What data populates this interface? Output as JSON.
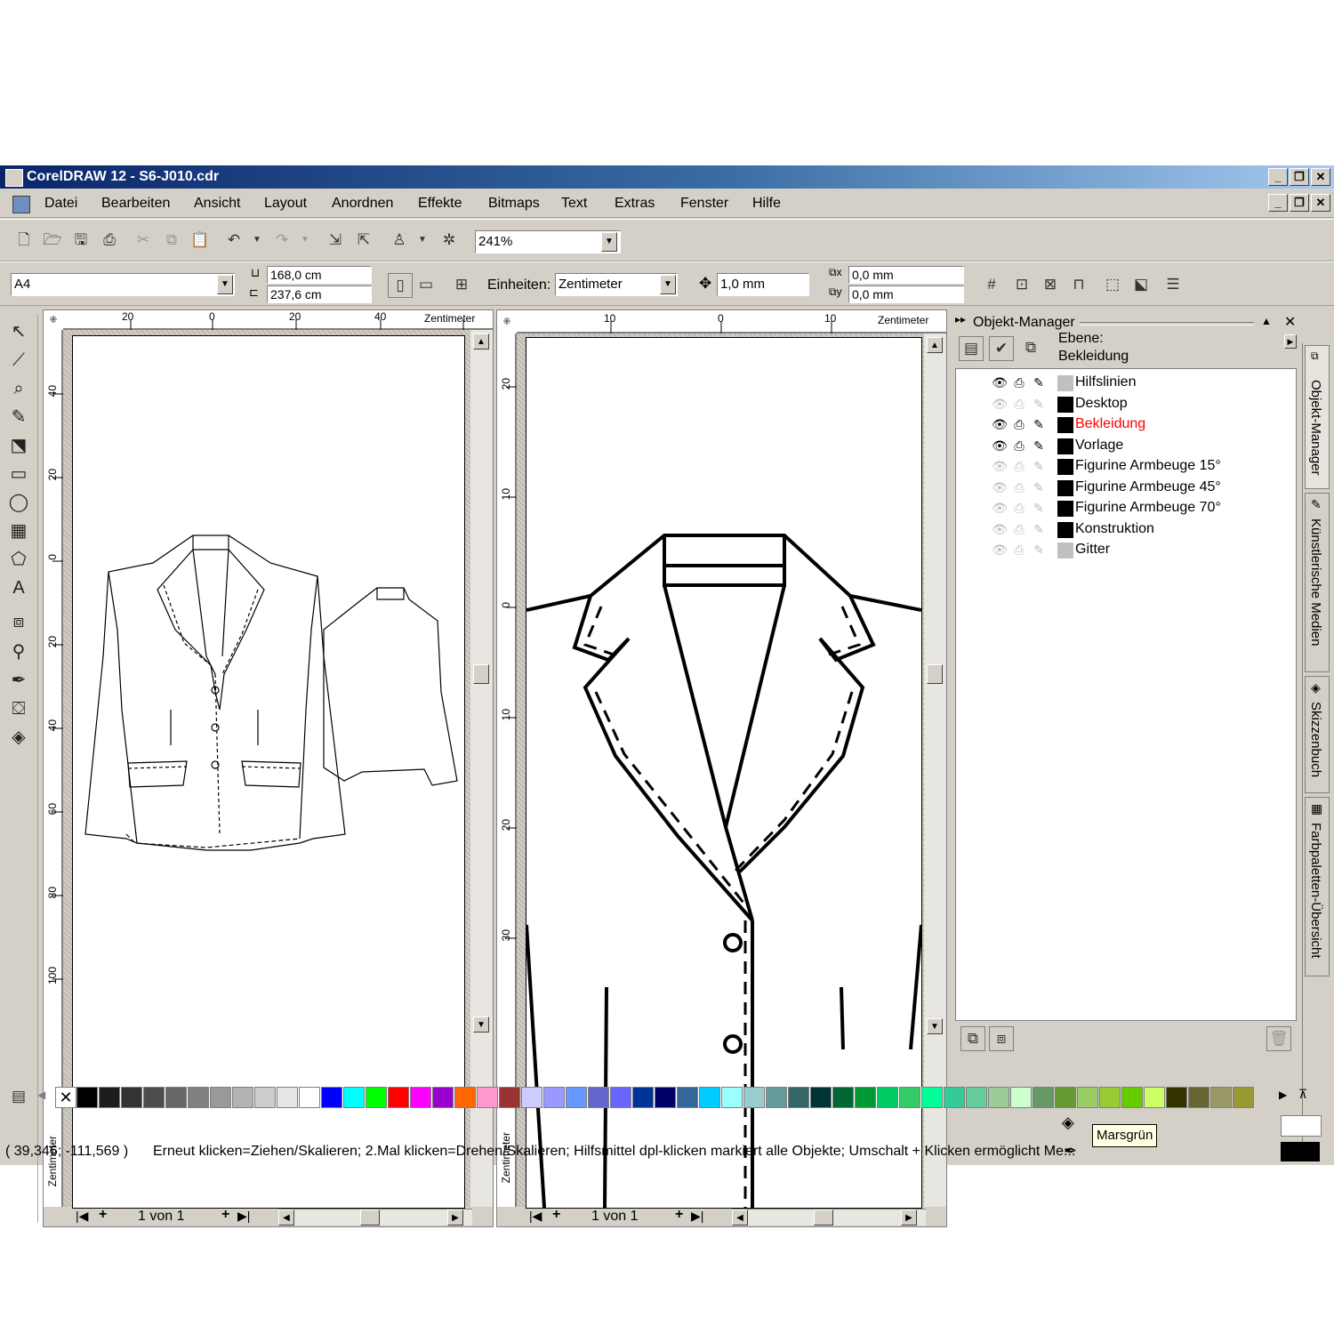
{
  "window": {
    "title": "CorelDRAW 12 - S6-J010.cdr"
  },
  "menu": [
    "Datei",
    "Bearbeiten",
    "Ansicht",
    "Layout",
    "Anordnen",
    "Effekte",
    "Bitmaps",
    "Text",
    "Extras",
    "Fenster",
    "Hilfe"
  ],
  "standard_toolbar": {
    "zoom": "241%"
  },
  "property_bar": {
    "paper_size": "A4",
    "width": "168,0 cm",
    "height": "237,6 cm",
    "units_label": "Einheiten:",
    "units_value": "Zentimeter",
    "nudge": "1,0 mm",
    "dup_x": "0,0 mm",
    "dup_y": "0,0 mm"
  },
  "left_view": {
    "ruler_unit": "Zentimeter",
    "h_ticks": [
      "20",
      "0",
      "20",
      "40"
    ],
    "v_ticks": [
      "40",
      "20",
      "0",
      "20",
      "40",
      "60",
      "80",
      "100"
    ],
    "page_nav": "1 von 1"
  },
  "right_view": {
    "ruler_unit": "Zentimeter",
    "h_ticks": [
      "10",
      "0",
      "10"
    ],
    "v_ticks": [
      "20",
      "10",
      "0",
      "10",
      "20",
      "30"
    ],
    "page_nav": "1 von 1"
  },
  "object_manager": {
    "title": "Objekt-Manager",
    "layer_label": "Ebene:",
    "layer_value": "Bekleidung",
    "layers": [
      {
        "name": "Hilfslinien",
        "color": "#c0c0c0",
        "active": false,
        "visible": true
      },
      {
        "name": "Desktop",
        "color": "#000000",
        "active": false,
        "visible": false
      },
      {
        "name": "Bekleidung",
        "color": "#000000",
        "active": true,
        "visible": true
      },
      {
        "name": "Vorlage",
        "color": "#000000",
        "active": false,
        "visible": true
      },
      {
        "name": "Figurine Armbeuge 15°",
        "color": "#000000",
        "active": false,
        "visible": false
      },
      {
        "name": "Figurine Armbeuge 45°",
        "color": "#000000",
        "active": false,
        "visible": false
      },
      {
        "name": "Figurine Armbeuge 70°",
        "color": "#000000",
        "active": false,
        "visible": false
      },
      {
        "name": "Konstruktion",
        "color": "#000000",
        "active": false,
        "visible": false
      },
      {
        "name": "Gitter",
        "color": "#c0c0c0",
        "active": false,
        "visible": false
      }
    ]
  },
  "docker_tabs": [
    "Objekt-Manager",
    "Künstlerische Medien",
    "Skizzenbuch",
    "Farbpaletten-Übersicht"
  ],
  "palette": [
    "#000000",
    "#1c1c1c",
    "#333333",
    "#4d4d4d",
    "#666666",
    "#808080",
    "#999999",
    "#b3b3b3",
    "#cccccc",
    "#e6e6e6",
    "#ffffff",
    "#0000ff",
    "#00ffff",
    "#00ff00",
    "#ff0000",
    "#ff00ff",
    "#9900cc",
    "#ff6600",
    "#ff99cc",
    "#993333",
    "#ccccff",
    "#9999ff",
    "#6699ff",
    "#6666cc",
    "#6666ff",
    "#003399",
    "#000066",
    "#336699",
    "#00ccff",
    "#99ffff",
    "#99cccc",
    "#669999",
    "#336666",
    "#003333",
    "#006633",
    "#009933",
    "#00cc66",
    "#33cc66",
    "#00ff99",
    "#33cc99",
    "#66cc99",
    "#99cc99",
    "#ccffcc",
    "#669966",
    "#669933",
    "#99cc66",
    "#99cc33",
    "#66cc00",
    "#ccff66",
    "#333300",
    "#666633",
    "#999966",
    "#999933"
  ],
  "tooltip": "Marsgrün",
  "status": {
    "coords": "( 39,346; -111,569 )",
    "message": "Erneut klicken=Ziehen/Skalieren; 2.Mal klicken=Drehen/Skalieren; Hilfsmittel dpl-klicken markiert alle Objekte; Umschalt + Klicken ermöglicht Me..."
  }
}
